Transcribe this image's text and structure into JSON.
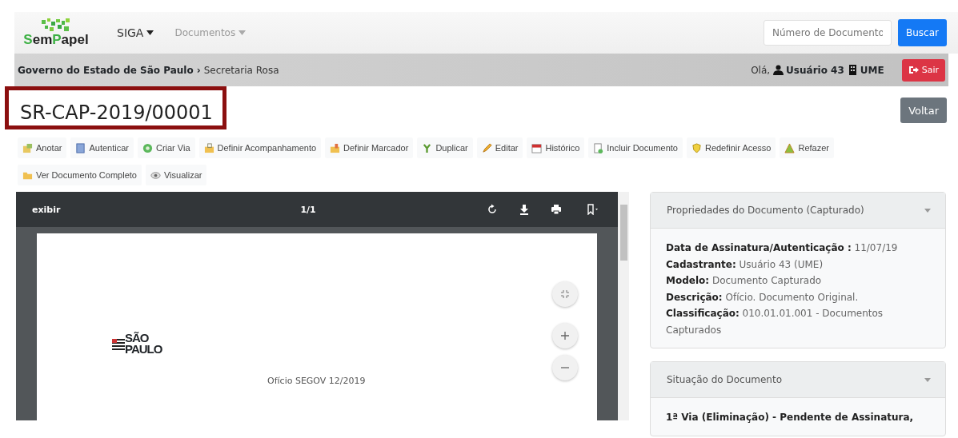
{
  "navbar": {
    "logo": {
      "parts": [
        {
          "text": "S",
          "accent": true
        },
        {
          "text": "em",
          "accent": false
        },
        {
          "text": "P",
          "accent": true
        },
        {
          "text": "apel",
          "accent": false
        }
      ]
    },
    "menus": [
      {
        "label": "SIGA",
        "disabled": false
      },
      {
        "label": "Documentos",
        "disabled": true
      }
    ],
    "search": {
      "placeholder": "Número de Documento"
    },
    "search_button": "Buscar"
  },
  "breadcrumb": {
    "org": "Governo do Estado de São Paulo",
    "separator": "›",
    "unit": "Secretaria Rosa",
    "greeting": "Olá,",
    "user": "Usuário 43",
    "unit_code": "UME",
    "logout": "Sair"
  },
  "document": {
    "title": "SR-CAP-2019/00001",
    "highlighted": true,
    "back_button": "Voltar"
  },
  "actions": [
    {
      "label": "Anotar",
      "kind": "note"
    },
    {
      "label": "Autenticar",
      "kind": "certificate"
    },
    {
      "label": "Criar Via",
      "kind": "circle"
    },
    {
      "label": "Definir Acompanhamento",
      "kind": "folder-lock"
    },
    {
      "label": "Definir Marcador",
      "kind": "folder-tag"
    },
    {
      "label": "Duplicar",
      "kind": "branch"
    },
    {
      "label": "Editar",
      "kind": "pencil"
    },
    {
      "label": "Histórico",
      "kind": "calendar"
    },
    {
      "label": "Incluir Documento",
      "kind": "page-add"
    },
    {
      "label": "Redefinir Acesso",
      "kind": "shield"
    },
    {
      "label": "Refazer",
      "kind": "triangle"
    },
    {
      "label": "Ver Documento Completo",
      "kind": "folder"
    },
    {
      "label": "Visualizar",
      "kind": "eye"
    }
  ],
  "viewer": {
    "title": "exibir",
    "page_count": "1/1",
    "page": {
      "logo_top": "SÃO",
      "logo_bottom": "PAULO",
      "heading": "Ofício SEGOV 12/2019"
    }
  },
  "panels": [
    {
      "title": "Propriedades do Documento (Capturado)",
      "expanded": true,
      "lines": [
        "**Data de Assinatura/Autenticação :** 11/07/19",
        "**Cadastrante:** Usuário 43 (UME)",
        "**Modelo:** Documento Capturado",
        "**Descrição:** Ofício. Documento Original.",
        "**Classificação:** 010.01.01.001 - Documentos Capturados"
      ]
    },
    {
      "title": "Situação do Documento",
      "expanded": true,
      "lines": [
        "**1ª Via (Eliminação) - Pendente de Assinatura,**"
      ]
    }
  ]
}
